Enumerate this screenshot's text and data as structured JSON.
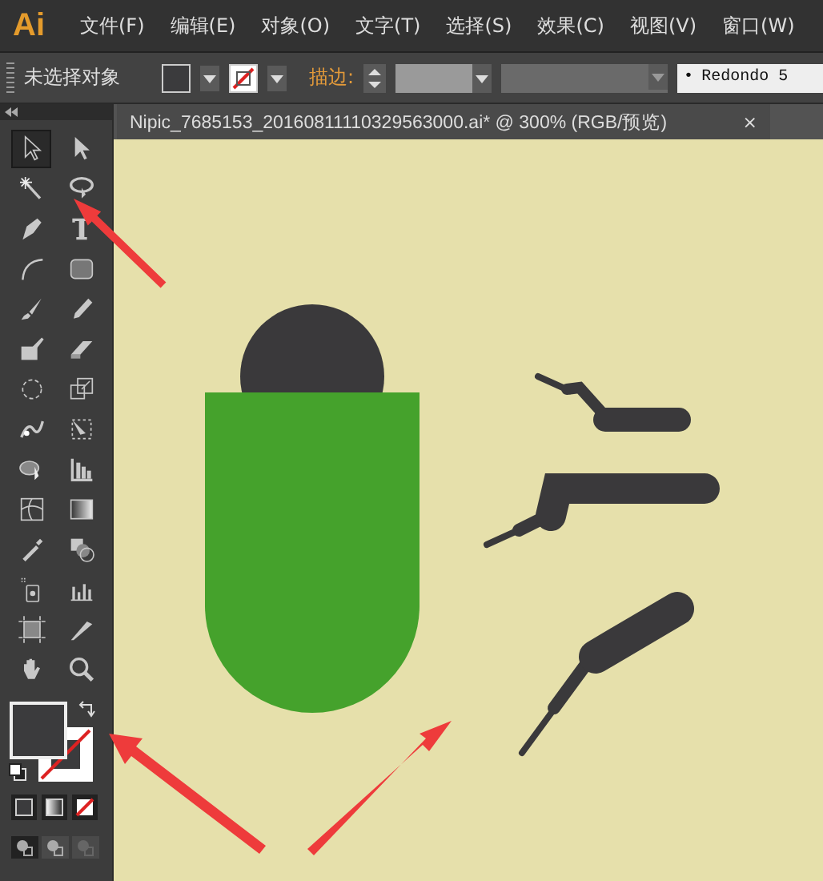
{
  "app": {
    "logo": "Ai"
  },
  "menu": [
    {
      "label": "文件(F)"
    },
    {
      "label": "编辑(E)"
    },
    {
      "label": "对象(O)"
    },
    {
      "label": "文字(T)"
    },
    {
      "label": "选择(S)"
    },
    {
      "label": "效果(C)"
    },
    {
      "label": "视图(V)"
    },
    {
      "label": "窗口(W)"
    }
  ],
  "control_bar": {
    "selection_status": "未选择对象",
    "stroke_label": "描边:",
    "font_field": {
      "bullet": "•",
      "value": "Redondo 5"
    }
  },
  "tools": [
    {
      "selected": true
    },
    {
      "selected": false
    },
    {
      "selected": false
    },
    {
      "selected": false
    },
    {
      "selected": false
    },
    {
      "selected": false
    },
    {
      "selected": false
    },
    {
      "selected": false
    },
    {
      "selected": false
    },
    {
      "selected": false
    },
    {
      "selected": false
    },
    {
      "selected": false
    },
    {
      "selected": false
    },
    {
      "selected": false
    },
    {
      "selected": false
    },
    {
      "selected": false
    },
    {
      "selected": false
    },
    {
      "selected": false
    },
    {
      "selected": false
    },
    {
      "selected": false
    },
    {
      "selected": false
    },
    {
      "selected": false
    },
    {
      "selected": false
    },
    {
      "selected": false
    },
    {
      "selected": false
    },
    {
      "selected": false
    },
    {
      "selected": false
    },
    {
      "selected": false
    }
  ],
  "document_tab": {
    "title": "Nipic_7685153_20160811110329563000.ai*  @  300%  (RGB/预览)",
    "close": "×"
  }
}
